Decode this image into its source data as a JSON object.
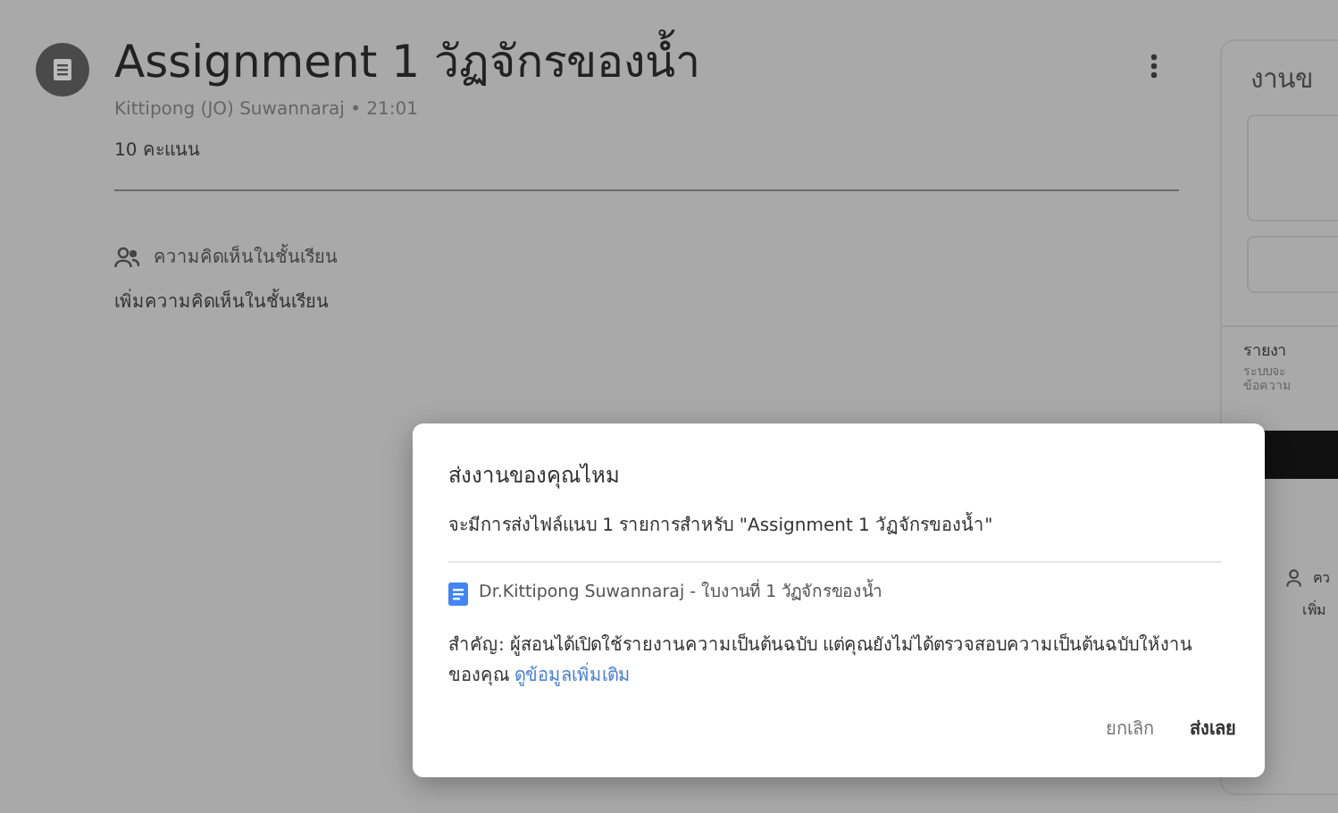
{
  "assignment": {
    "title": "Assignment 1 วัฏจักรของน้ำ",
    "meta": "Kittipong (JO) Suwannaraj • 21:01",
    "points": "10 คะแนน"
  },
  "comments": {
    "heading": "ความคิดเห็นในชั้นเรียน",
    "add": "เพิ่มความคิดเห็นในชั้นเรียน"
  },
  "side_panel": {
    "title": "งานข",
    "report_title": "รายงา",
    "report_lines": [
      "ระบบจะ",
      "ข้อความ"
    ],
    "comments_heading": "คว",
    "comments_add": "เพิ่ม"
  },
  "dialog": {
    "title": "ส่งงานของคุณไหม",
    "message": "จะมีการส่งไฟล์แนบ 1 รายการสำหรับ \"Assignment 1 วัฏจักรของน้ำ\"",
    "attachment": "Dr.Kittipong Suwannaraj - ใบงานที่ 1 วัฏจักรของน้ำ",
    "notice": "สำคัญ: ผู้สอนได้เปิดใช้รายงานความเป็นต้นฉบับ แต่คุณยังไม่ได้ตรวจสอบความเป็นต้นฉบับให้งานของคุณ",
    "notice_link": "ดูข้อมูลเพิ่มเติม",
    "buttons": [
      {
        "label": "ยกเลิก",
        "kind": "secondary"
      },
      {
        "label": "ส่งเลย",
        "kind": "primary"
      }
    ]
  }
}
